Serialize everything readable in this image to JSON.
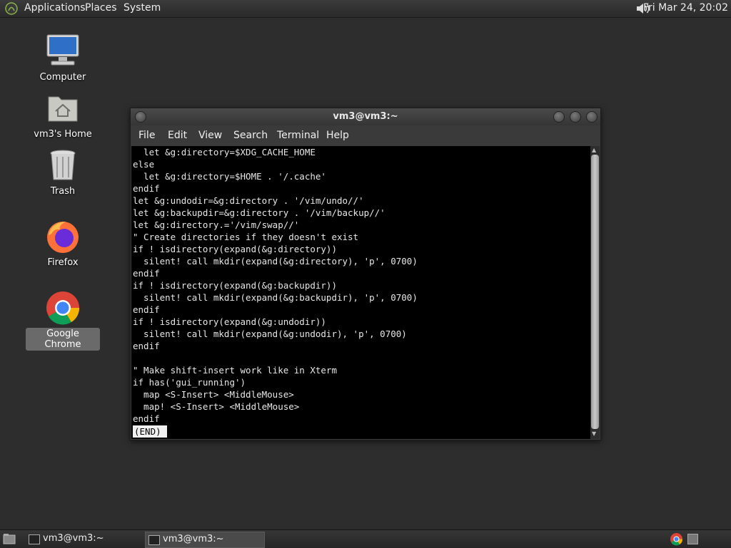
{
  "top_panel": {
    "menus": [
      "Applications",
      "Places",
      "System"
    ],
    "clock": "Fri Mar 24, 20:02"
  },
  "desktop": {
    "icons": [
      {
        "label": "Computer"
      },
      {
        "label": "vm3's Home"
      },
      {
        "label": "Trash"
      },
      {
        "label": "Firefox"
      },
      {
        "label": "Google Chrome"
      }
    ]
  },
  "terminal": {
    "title": "vm3@vm3:~",
    "menus": [
      "File",
      "Edit",
      "View",
      "Search",
      "Terminal",
      "Help"
    ],
    "lines": [
      "  let &g:directory=$XDG_CACHE_HOME",
      "else",
      "  let &g:directory=$HOME . '/.cache'",
      "endif",
      "let &g:undodir=&g:directory . '/vim/undo//'",
      "let &g:backupdir=&g:directory . '/vim/backup//'",
      "let &g:directory.='/vim/swap//'",
      "\" Create directories if they doesn't exist",
      "if ! isdirectory(expand(&g:directory))",
      "  silent! call mkdir(expand(&g:directory), 'p', 0700)",
      "endif",
      "if ! isdirectory(expand(&g:backupdir))",
      "  silent! call mkdir(expand(&g:backupdir), 'p', 0700)",
      "endif",
      "if ! isdirectory(expand(&g:undodir))",
      "  silent! call mkdir(expand(&g:undodir), 'p', 0700)",
      "endif",
      "",
      "\" Make shift-insert work like in Xterm",
      "if has('gui_running')",
      "  map <S-Insert> <MiddleMouse>",
      "  map! <S-Insert> <MiddleMouse>",
      "endif"
    ],
    "status": "(END)"
  },
  "taskbar": {
    "tasks": [
      {
        "label": "vm3@vm3:~"
      },
      {
        "label": "vm3@vm3:~"
      }
    ]
  }
}
